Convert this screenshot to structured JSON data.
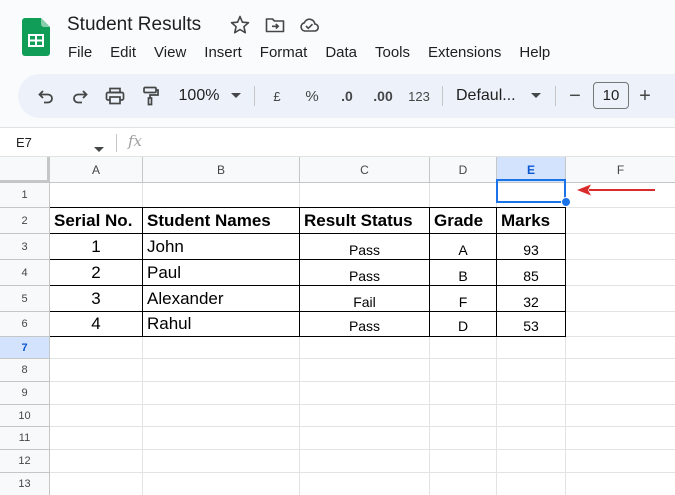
{
  "app": {
    "title": "Student Results",
    "menu": [
      "File",
      "Edit",
      "View",
      "Insert",
      "Format",
      "Data",
      "Tools",
      "Extensions",
      "Help"
    ]
  },
  "toolbar": {
    "zoom": "100%",
    "currency": "£",
    "percent": "%",
    "decrease_decimal": ".0",
    "increase_decimal": ".00",
    "number_format": "123",
    "font": "Defaul...",
    "font_size": "10",
    "decrease_font": "−",
    "increase_font": "+"
  },
  "formula_bar": {
    "name_box": "E7",
    "fx": "fx"
  },
  "sheet": {
    "columns": [
      "A",
      "B",
      "C",
      "D",
      "E",
      "F"
    ],
    "rows": [
      "1",
      "2",
      "3",
      "4",
      "5",
      "6",
      "7",
      "8",
      "9",
      "10",
      "11",
      "12",
      "13"
    ],
    "selected_column": "E",
    "selected_row": "7",
    "table_headers": [
      "Serial No.",
      "Student Names",
      "Result Status",
      "Grade",
      "Marks"
    ],
    "table_rows": [
      {
        "serial": "1",
        "name": "John",
        "status": "Pass",
        "grade": "A",
        "marks": "93"
      },
      {
        "serial": "2",
        "name": "Paul",
        "status": "Pass",
        "grade": "B",
        "marks": "85"
      },
      {
        "serial": "3",
        "name": "Alexander",
        "status": "Fail",
        "grade": "F",
        "marks": "32"
      },
      {
        "serial": "4",
        "name": "Rahul",
        "status": "Pass",
        "grade": "D",
        "marks": "53"
      }
    ]
  },
  "colors": {
    "accent": "#1a73e8",
    "annotation_arrow": "#d92b2b",
    "logo_green": "#0f9d58"
  }
}
